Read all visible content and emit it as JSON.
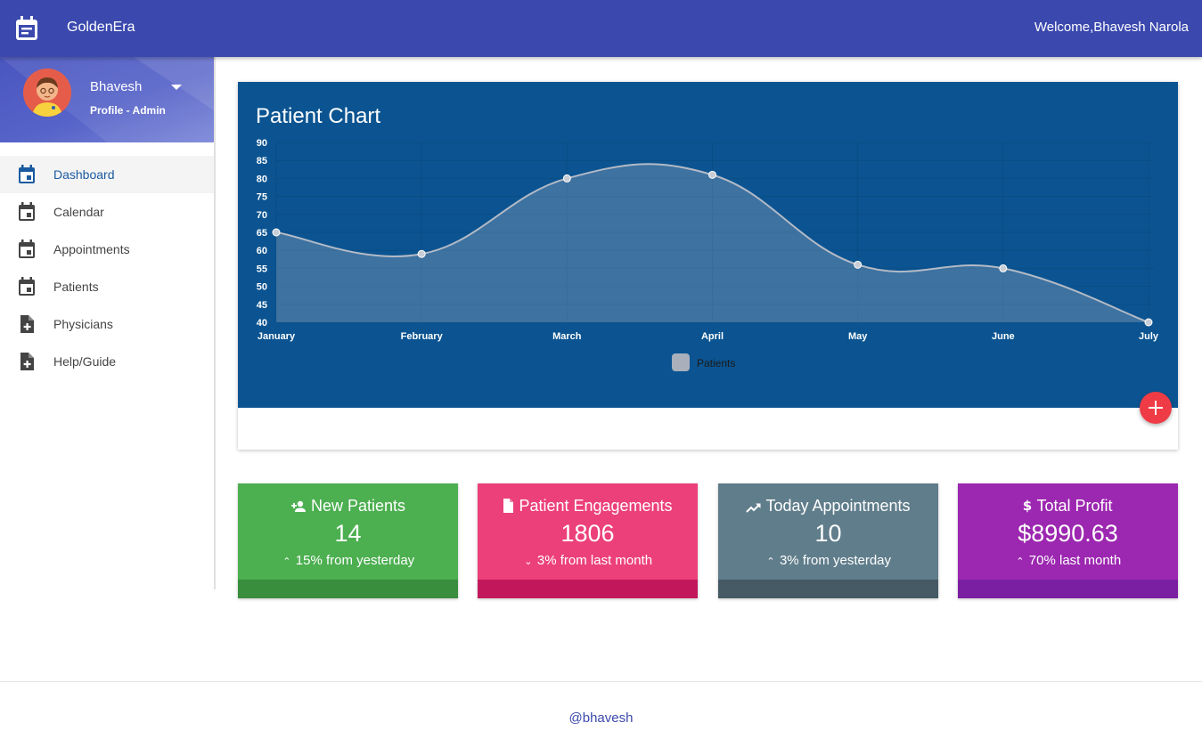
{
  "topbar": {
    "app_title": "GoldenEra",
    "welcome": "Welcome,Bhavesh Narola"
  },
  "profile": {
    "name": "Bhavesh",
    "role": "Profile - Admin"
  },
  "sidebar": {
    "items": [
      {
        "label": "Dashboard",
        "icon": "calendar-icon",
        "active": true
      },
      {
        "label": "Calendar",
        "icon": "calendar-icon"
      },
      {
        "label": "Appointments",
        "icon": "calendar-icon"
      },
      {
        "label": "Patients",
        "icon": "calendar-icon"
      },
      {
        "label": "Physicians",
        "icon": "file-plus-icon"
      },
      {
        "label": "Help/Guide",
        "icon": "file-plus-icon"
      }
    ]
  },
  "chart": {
    "title": "Patient Chart"
  },
  "chart_data": {
    "type": "area",
    "title": "Patient Chart",
    "categories": [
      "January",
      "February",
      "March",
      "April",
      "May",
      "June",
      "July"
    ],
    "series": [
      {
        "name": "Patients",
        "values": [
          65,
          59,
          80,
          81,
          56,
          55,
          40
        ]
      }
    ],
    "ylim": [
      40,
      90
    ],
    "yticks": [
      40,
      45,
      50,
      55,
      60,
      65,
      70,
      75,
      80,
      85,
      90
    ],
    "grid": true,
    "legend": "bottom-center",
    "colors": {
      "background": "#0b5491",
      "line": "#b3bac6",
      "fill": "rgba(179,186,198,0.3)"
    }
  },
  "stats": [
    {
      "title": "New Patients",
      "icon": "person-add-icon",
      "value": "14",
      "sub": "15% from yesterday",
      "trend": "up",
      "color": "#4caf50",
      "foot": "#388e3c"
    },
    {
      "title": "Patient Engagements",
      "icon": "document-icon",
      "value": "1806",
      "sub": "3% from last month",
      "trend": "down",
      "color": "#ec407a",
      "foot": "#c2185b"
    },
    {
      "title": "Today Appointments",
      "icon": "trending-up-icon",
      "value": "10",
      "sub": "3% from yesterday",
      "trend": "up",
      "color": "#607d8b",
      "foot": "#455a64"
    },
    {
      "title": "Total Profit",
      "icon": "dollar-icon",
      "value": "$8990.63",
      "sub": "70% last month",
      "trend": "up",
      "color": "#9c27b0",
      "foot": "#7b1fa2"
    }
  ],
  "footer": {
    "text": "@bhavesh"
  }
}
